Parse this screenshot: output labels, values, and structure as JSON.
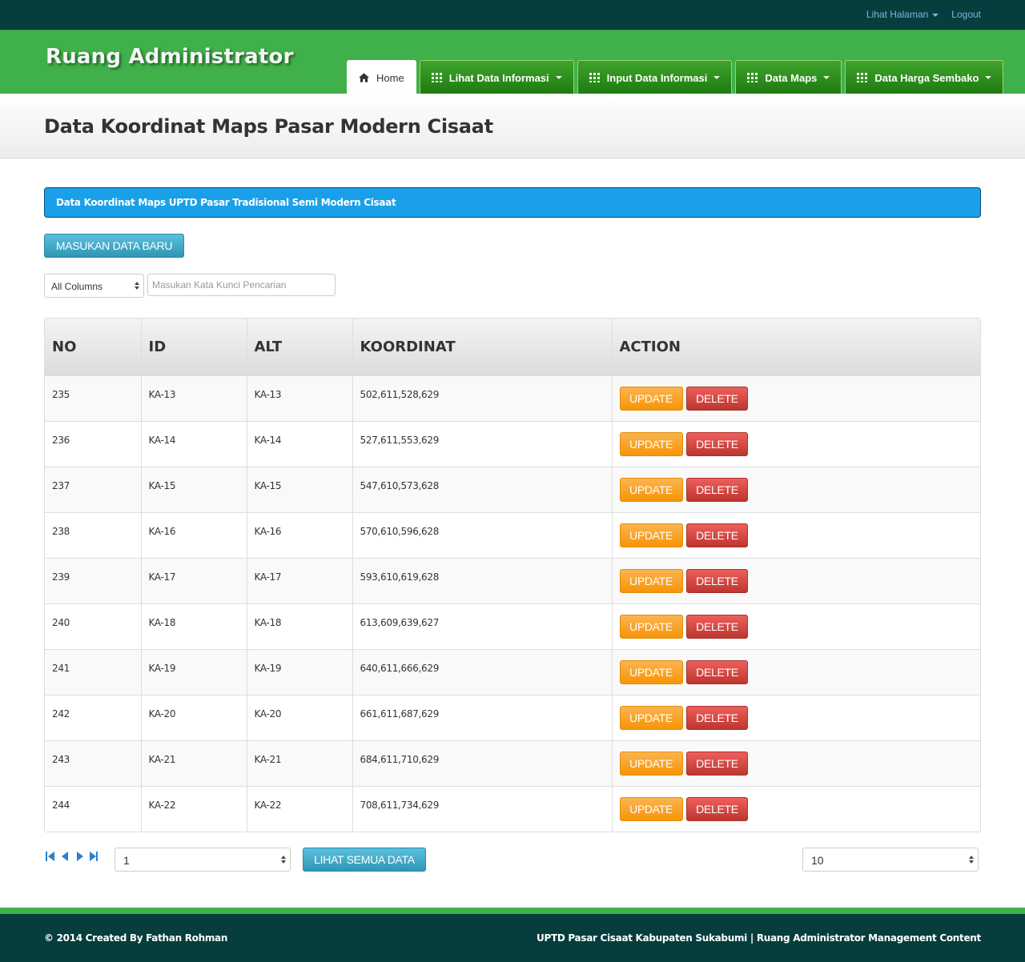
{
  "topbar": {
    "view_page": "Lihat Halaman",
    "logout": "Logout"
  },
  "brand": "Ruang Administrator",
  "nav": [
    {
      "label": "Home",
      "icon": "home-icon",
      "active": true,
      "dropdown": false
    },
    {
      "label": "Lihat Data Informasi",
      "icon": "grid-icon",
      "active": false,
      "dropdown": true
    },
    {
      "label": "Input Data Informasi",
      "icon": "grid-icon",
      "active": false,
      "dropdown": true
    },
    {
      "label": "Data Maps",
      "icon": "grid-icon",
      "active": false,
      "dropdown": true
    },
    {
      "label": "Data Harga Sembako",
      "icon": "grid-icon",
      "active": false,
      "dropdown": true
    }
  ],
  "page_title": "Data Koordinat Maps Pasar Modern Cisaat",
  "info_banner": "Data Koordinat Maps UPTD Pasar Tradisional Semi Modern Cisaat",
  "new_button": "MASUKAN DATA BARU",
  "filter": {
    "column_select": "All Columns",
    "search_placeholder": "Masukan Kata Kunci Pencarian"
  },
  "table": {
    "headers": [
      "NO",
      "ID",
      "ALT",
      "KOORDINAT",
      "ACTION"
    ],
    "update_label": "UPDATE",
    "delete_label": "DELETE",
    "rows": [
      {
        "no": "235",
        "id": "KA-13",
        "alt": "KA-13",
        "koordinat": "502,611,528,629"
      },
      {
        "no": "236",
        "id": "KA-14",
        "alt": "KA-14",
        "koordinat": "527,611,553,629"
      },
      {
        "no": "237",
        "id": "KA-15",
        "alt": "KA-15",
        "koordinat": "547,610,573,628"
      },
      {
        "no": "238",
        "id": "KA-16",
        "alt": "KA-16",
        "koordinat": "570,610,596,628"
      },
      {
        "no": "239",
        "id": "KA-17",
        "alt": "KA-17",
        "koordinat": "593,610,619,628"
      },
      {
        "no": "240",
        "id": "KA-18",
        "alt": "KA-18",
        "koordinat": "613,609,639,627"
      },
      {
        "no": "241",
        "id": "KA-19",
        "alt": "KA-19",
        "koordinat": "640,611,666,629"
      },
      {
        "no": "242",
        "id": "KA-20",
        "alt": "KA-20",
        "koordinat": "661,611,687,629"
      },
      {
        "no": "243",
        "id": "KA-21",
        "alt": "KA-21",
        "koordinat": "684,611,710,629"
      },
      {
        "no": "244",
        "id": "KA-22",
        "alt": "KA-22",
        "koordinat": "708,611,734,629"
      }
    ]
  },
  "pager": {
    "page": "1",
    "view_all": "LIHAT SEMUA DATA",
    "rows_per_page": "10"
  },
  "footer": {
    "left": "© 2014 Created By Fathan Rohman",
    "right": "UPTD Pasar Cisaat Kabupaten Sukabumi | Ruang Administrator Management Content"
  },
  "colors": {
    "brand_green": "#40b04b",
    "dark_teal": "#063d3d",
    "info_blue": "#1aa0e8",
    "update": "#f89406",
    "delete": "#bd362f"
  }
}
